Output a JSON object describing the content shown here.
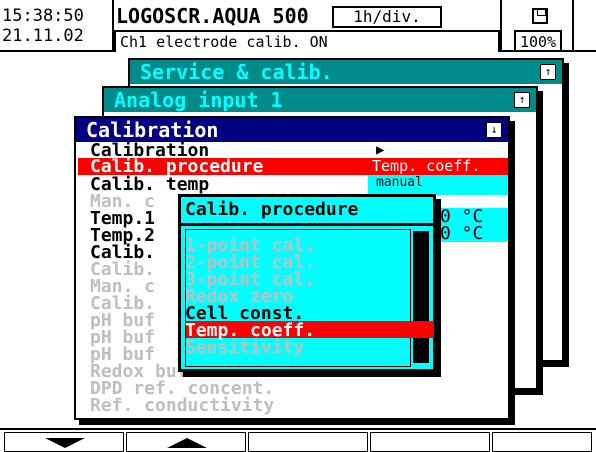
{
  "header": {
    "time": "15:38:50",
    "date": "21.11.02",
    "device": "LOGOSCR.AQUA 500",
    "timebase": "1h/div.",
    "status": "Ch1 electrode calib. ON",
    "memory_percent": "100%",
    "memory_icon": "floppy-disk-icon"
  },
  "windows": {
    "service": {
      "title": "Service & calib."
    },
    "analog": {
      "title": "Analog input 1"
    },
    "calibration": {
      "title": "Calibration",
      "items": [
        {
          "label": "Calibration",
          "value": "▶",
          "state": "normal"
        },
        {
          "label": "Calib. procedure",
          "value": "Temp. coeff.",
          "state": "selected"
        },
        {
          "label": "Calib. temp",
          "value": "manual",
          "state": "normal"
        },
        {
          "label": "Man. c",
          "value": "",
          "state": "dim"
        },
        {
          "label": "Temp.1",
          "value": "0 °C",
          "state": "normal"
        },
        {
          "label": "Temp.2",
          "value": "0 °C",
          "state": "normal"
        },
        {
          "label": "Calib.",
          "value": "",
          "state": "normal"
        },
        {
          "label": "Calib.",
          "value": "",
          "state": "dim"
        },
        {
          "label": "Man. c",
          "value": "",
          "state": "dim"
        },
        {
          "label": "Calib.",
          "value": "",
          "state": "dim"
        },
        {
          "label": "pH buf",
          "value": "",
          "state": "dim"
        },
        {
          "label": "pH buf",
          "value": "",
          "state": "dim"
        },
        {
          "label": "pH buf",
          "value": "",
          "state": "dim"
        },
        {
          "label": "Redox buffer",
          "value": "",
          "state": "dim"
        },
        {
          "label": "DPD ref. concent.",
          "value": "",
          "state": "dim"
        },
        {
          "label": "Ref. conductivity",
          "value": "",
          "state": "dim"
        }
      ]
    }
  },
  "popup": {
    "title": "Calib. procedure",
    "options": [
      {
        "label": "1-point cal.",
        "state": "disabled"
      },
      {
        "label": "2-point cal.",
        "state": "disabled"
      },
      {
        "label": "3-point cal.",
        "state": "disabled"
      },
      {
        "label": "Redox zero",
        "state": "disabled"
      },
      {
        "label": "Cell const.",
        "state": "enabled"
      },
      {
        "label": "Temp. coeff.",
        "state": "selected"
      },
      {
        "label": "Sensitivity",
        "state": "disabled"
      }
    ]
  },
  "softkeys": [
    "arrow-down-icon",
    "arrow-up-icon",
    "",
    "",
    ""
  ],
  "colors": {
    "teal": "#008b8b",
    "cyan": "#00ffff",
    "navy": "#000080",
    "red": "#ff0000",
    "dim": "#bfbfbf"
  }
}
